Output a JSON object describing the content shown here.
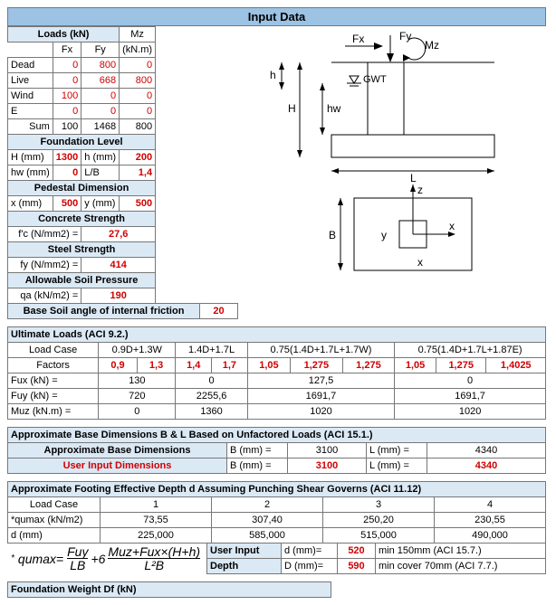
{
  "title": "Input Data",
  "load_hdr": "Loads (kN)",
  "mz_hdr": "Mz",
  "fx": "Fx",
  "fy": "Fy",
  "knm": "(kN.m)",
  "rows": {
    "dead": {
      "lbl": "Dead",
      "fx": "0",
      "fy": "800",
      "mz": "0"
    },
    "live": {
      "lbl": "Live",
      "fx": "0",
      "fy": "668",
      "mz": "800"
    },
    "wind": {
      "lbl": "Wind",
      "fx": "100",
      "fy": "0",
      "mz": "0"
    },
    "e": {
      "lbl": "E",
      "fx": "0",
      "fy": "0",
      "mz": "0"
    },
    "sum": {
      "lbl": "Sum",
      "fx": "100",
      "fy": "1468",
      "mz": "800"
    }
  },
  "found_hdr": "Foundation Level",
  "fl": {
    "H": "H (mm)",
    "Hv": "1300",
    "h": "h (mm)",
    "hv": "200",
    "hw": "hw (mm)",
    "hwv": "0",
    "lb": "L/B",
    "lbv": "1,4"
  },
  "ped_hdr": "Pedestal Dimension",
  "ped": {
    "x": "x (mm)",
    "xv": "500",
    "y": "y (mm)",
    "yv": "500"
  },
  "conc_hdr": "Concrete Strength",
  "conc": {
    "lbl": "f'c (N/mm2) =",
    "v": "27,6"
  },
  "steel_hdr": "Steel Strength",
  "steel": {
    "lbl": "fy (N/mm2) =",
    "v": "414"
  },
  "asp_hdr": "Allowable Soil Pressure",
  "asp": {
    "lbl": "qa (kN/m2) =",
    "v": "190"
  },
  "bsaf": {
    "lbl": "Base Soil angle of internal friction",
    "v": "20"
  },
  "diag": {
    "fx": "Fx",
    "fy": "Fy",
    "mz": "Mz",
    "gwt": "GWT",
    "h": "h",
    "H": "H",
    "hw": "hw",
    "L": "L",
    "B": "B",
    "x": "x",
    "y": "y",
    "z": "z"
  },
  "ul_hdr": "Ultimate Loads (ACI 9.2.)",
  "ul": {
    "lc": "Load Case",
    "factors": "Factors",
    "fux": "Fux (kN) =",
    "fuy": "Fuy (kN) =",
    "muz": "Muz (kN.m) =",
    "c1": "0.9D+1.3W",
    "c2": "1.4D+1.7L",
    "c3": "0.75(1.4D+1.7L+1.7W)",
    "c4": "0.75(1.4D+1.7L+1.87E)",
    "f": [
      "0,9",
      "1,3",
      "1,4",
      "1,7",
      "1,05",
      "1,275",
      "1,275",
      "1,05",
      "1,275",
      "1,4025"
    ],
    "fuxv": [
      "130",
      "0",
      "127,5",
      "0"
    ],
    "fuyv": [
      "720",
      "2255,6",
      "1691,7",
      "1691,7"
    ],
    "muzv": [
      "0",
      "1360",
      "1020",
      "1020"
    ]
  },
  "bd_hdr": "Approximate Base Dimensions  B & L Based on Unfactored Loads (ACI 15.1.)",
  "bd": {
    "r1": "Approximate Base Dimensions",
    "r2": "User Input Dimensions",
    "bl": "B (mm) =",
    "ll": "L (mm) =",
    "b1": "3100",
    "l1": "4340",
    "b2": "3100",
    "l2": "4340"
  },
  "fd_hdr": "Approximate Footing Effective Depth d Assuming Punching Shear Governs (ACI 11.12)",
  "fd": {
    "lc": "Load Case",
    "c": [
      "1",
      "2",
      "3",
      "4"
    ],
    "q": "*qumax (kN/m2)",
    "qv": [
      "73,55",
      "307,40",
      "250,20",
      "230,55"
    ],
    "d": "d (mm)",
    "dv": [
      "225,000",
      "585,000",
      "515,000",
      "490,000"
    ],
    "ui": "User Input",
    "depth": "Depth",
    "dmm": "d (mm)=",
    "dmmv": "520",
    "Dmm": "D (mm)=",
    "Dmmv": "590",
    "min1": "min 150mm (ACI 15.7.)",
    "min2": "min cover 70mm (ACI 7.7.)"
  },
  "fw_hdr": "Foundation Weight Df (kN)"
}
